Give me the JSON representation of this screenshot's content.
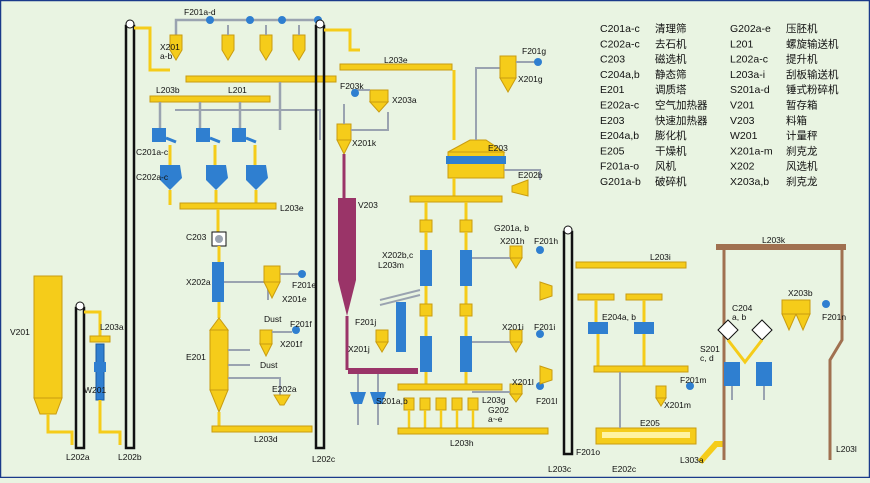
{
  "diagram": {
    "labels": {
      "V201": "V201",
      "L202a": "L202a",
      "L203a": "L203a",
      "W201": "W201",
      "L202b": "L202b",
      "F201a_d": "F201a-d",
      "X201a_b": "X201\na-b",
      "L203b": "L203b",
      "L201": "L201",
      "C201a_c": "C201a-c",
      "C202a_c": "C202a-c",
      "L203e_left": "L203e",
      "C203": "C203",
      "X202a": "X202a",
      "F201e": "F201e",
      "X201e": "X201e",
      "Dust1": "Dust",
      "F201f": "F201f",
      "X201f": "X201f",
      "Dust2": "Dust",
      "E201": "E201",
      "E202a": "E202a",
      "L203d": "L203d",
      "L202c": "L202c",
      "L203e_top": "L203e",
      "F203k": "F203k",
      "X203a": "X203a",
      "X201k": "X201k",
      "V203": "V203",
      "F201g": "F201g",
      "X201g": "X201g",
      "E203": "E203",
      "E202b": "E202b",
      "G201a_b": "G201a, b",
      "X201h": "X201h",
      "F201h": "F201h",
      "X202b_c": "X202b,c",
      "L203m": "L203m",
      "F201j": "F201j",
      "X201j": "X201j",
      "X201i": "X201i",
      "F201i": "F201i",
      "S201a_b": "S201a,b",
      "X201l": "X201l",
      "F201l": "F201l",
      "L203g": "L203g",
      "G202": "G202\na~e",
      "L203h": "L203h",
      "L203i": "L203i",
      "E204a_b": "E204a, b",
      "F201m": "F201m",
      "X201m": "X201m",
      "E205": "E205",
      "F201o": "F201o",
      "E202c": "E202c",
      "L303a": "L303a",
      "L203c": "L203c",
      "L203k": "L203k",
      "C204": "C204\na, b",
      "X203b": "X203b",
      "F201n": "F201n",
      "S201c_d": "S201\nc, d",
      "L203l": "L203l"
    },
    "legend_left": [
      {
        "code": "C201a-c",
        "name": "清理筛"
      },
      {
        "code": "C202a-c",
        "name": "去石机"
      },
      {
        "code": "C203",
        "name": "磁选机"
      },
      {
        "code": "C204a,b",
        "name": "静态筛"
      },
      {
        "code": "E201",
        "name": "调质塔"
      },
      {
        "code": "E202a-c",
        "name": "空气加热器"
      },
      {
        "code": "E203",
        "name": "快速加热器"
      },
      {
        "code": "E204a,b",
        "name": "膨化机"
      },
      {
        "code": "E205",
        "name": "干燥机"
      },
      {
        "code": "F201a-o",
        "name": "风机"
      },
      {
        "code": "G201a-b",
        "name": "破碎机"
      }
    ],
    "legend_right": [
      {
        "code": "G202a-e",
        "name": "压胚机"
      },
      {
        "code": "L201",
        "name": "螺旋输送机"
      },
      {
        "code": "L202a-c",
        "name": "提升机"
      },
      {
        "code": "L203a-i",
        "name": "刮板输送机"
      },
      {
        "code": "S201a-d",
        "name": "锤式粉碎机"
      },
      {
        "code": "V201",
        "name": "暂存箱"
      },
      {
        "code": "V203",
        "name": "料箱"
      },
      {
        "code": "W201",
        "name": "计量秤"
      },
      {
        "code": "X201a-m",
        "name": "刹克龙"
      },
      {
        "code": "X202",
        "name": "风选机"
      },
      {
        "code": "X203a,b",
        "name": "刹克龙"
      }
    ],
    "colors": {
      "background": "#e9f4e2",
      "yellow": "#f5cc1a",
      "yellow_dark": "#c99c10",
      "blue": "#2f7fd0",
      "gray_pipe": "#9aa3b0",
      "purple": "#9a3468",
      "brown": "#a07050",
      "black": "#111111",
      "border": "#1a3a8a"
    }
  }
}
